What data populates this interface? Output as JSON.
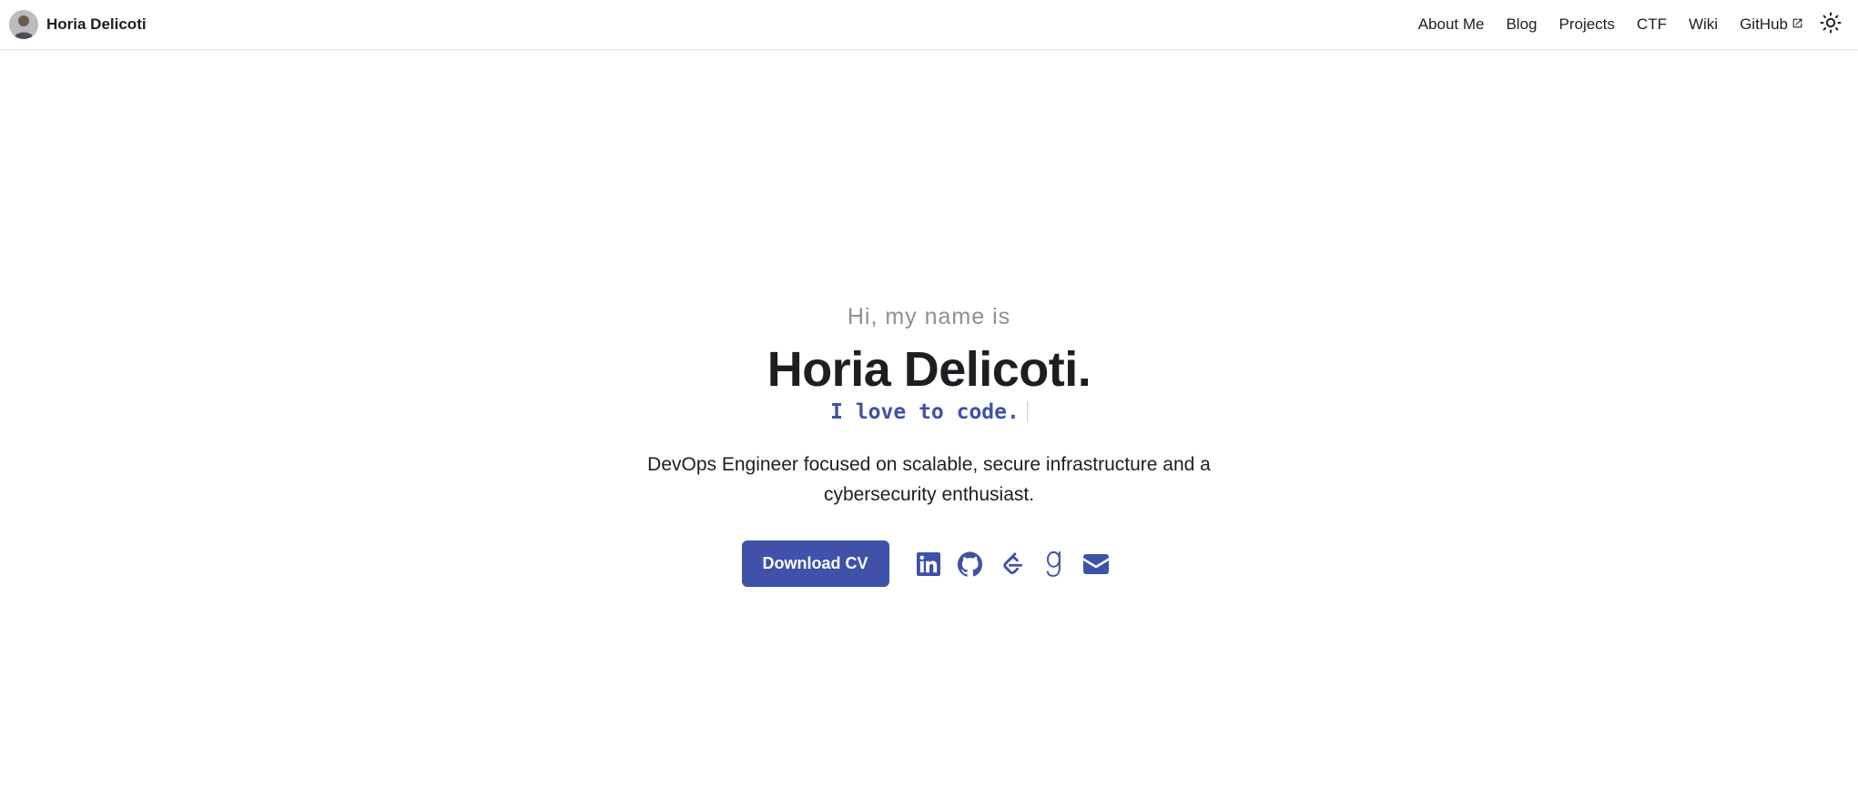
{
  "navbar": {
    "brand_title": "Horia Delicoti",
    "links": [
      {
        "label": "About Me"
      },
      {
        "label": "Blog"
      },
      {
        "label": "Projects"
      },
      {
        "label": "CTF"
      },
      {
        "label": "Wiki"
      },
      {
        "label": "GitHub",
        "icon": "external-link-icon"
      }
    ],
    "theme_toggle_icon": "sun-icon"
  },
  "hero": {
    "greeting": "Hi, my name is",
    "name": "Horia Delicoti.",
    "typed_text": "I love to code.",
    "tagline": "DevOps Engineer focused on scalable, secure infrastructure and a cybersecurity enthusiast.",
    "cv_button_label": "Download CV",
    "social_icons": [
      "linkedin-icon",
      "github-icon",
      "leetcode-icon",
      "goodreads-icon",
      "email-icon"
    ]
  },
  "colors": {
    "accent": "#3f51a8",
    "text": "#1c1e21",
    "muted": "#8d8f94",
    "background": "#ffffff"
  }
}
